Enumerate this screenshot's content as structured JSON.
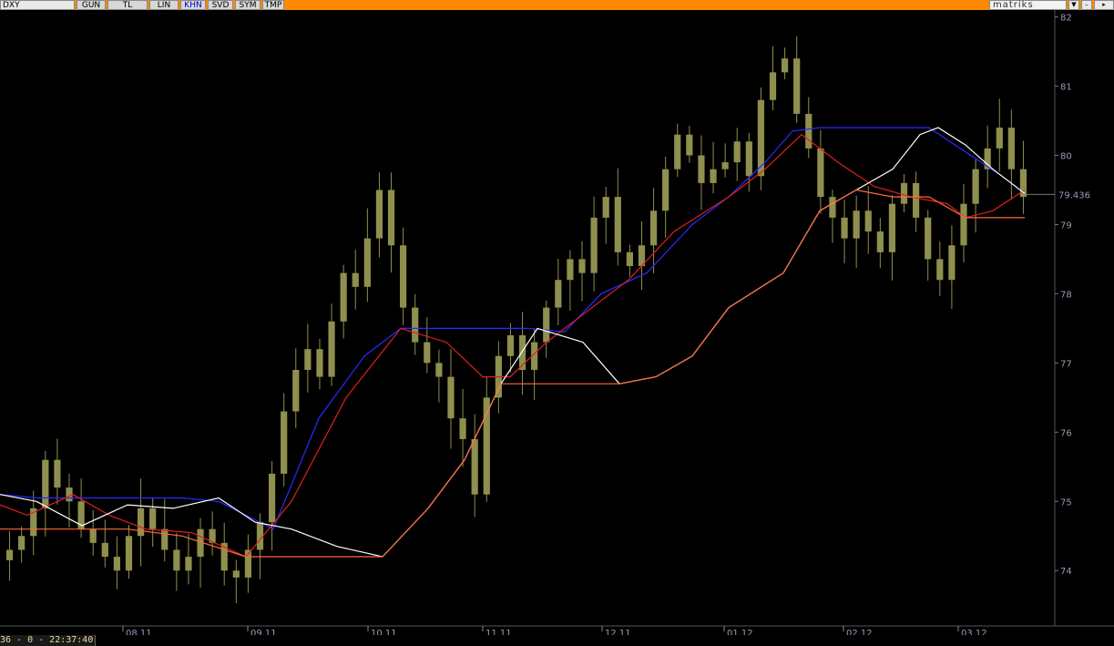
{
  "toolbar": {
    "symbol": "DXY",
    "buttons": [
      "GUN",
      "TL",
      "LIN",
      "KHN",
      "SVD",
      "SYM",
      "TMP"
    ],
    "active": "KHN",
    "brand": "matriks"
  },
  "status": {
    "text": "36 - 0 - 22:37:40"
  },
  "colors": {
    "background": "#000000",
    "candle": "#8f8f4f",
    "ma_blue": "#2a2aff",
    "ma_red": "#e02020",
    "ma_white": "#ffffff",
    "ma_orange": "#ff6a3a",
    "axis_text": "#9a9ab8",
    "toolbar": "#ff8a00"
  },
  "chart_data": {
    "type": "candlestick",
    "current_price": "79.436",
    "y_ticks": [
      "74",
      "75",
      "76",
      "77",
      "78",
      "79",
      "80",
      "81",
      "82"
    ],
    "ylim": [
      73.2,
      82.1
    ],
    "x_labels": [
      "08.11",
      "09.11",
      "10.11",
      "11.11",
      "12.11",
      "01.12",
      "02.12",
      "03.12"
    ],
    "series": [
      {
        "kind": "ohlc",
        "closes": [
          74.3,
          74.5,
          74.9,
          75.6,
          75.2,
          75.0,
          74.6,
          74.4,
          74.2,
          74.0,
          74.5,
          74.9,
          74.6,
          74.3,
          74.0,
          74.2,
          74.6,
          74.4,
          74.0,
          73.9,
          74.3,
          74.7,
          75.4,
          76.3,
          76.9,
          77.2,
          76.8,
          77.6,
          78.3,
          78.1,
          78.8,
          79.5,
          78.7,
          77.8,
          77.3,
          77.0,
          76.8,
          76.2,
          75.9,
          75.1,
          76.5,
          77.1,
          77.4,
          76.9,
          77.3,
          77.8,
          78.2,
          78.5,
          78.3,
          79.1,
          79.4,
          78.6,
          78.4,
          78.7,
          79.2,
          79.8,
          80.3,
          80.0,
          79.6,
          79.8,
          79.9,
          80.2,
          79.7,
          80.8,
          81.2,
          81.4,
          80.6,
          80.1,
          79.4,
          79.1,
          78.8,
          79.2,
          78.9,
          78.6,
          79.3,
          79.6,
          79.1,
          78.5,
          78.2,
          78.7,
          79.3,
          79.8,
          80.1,
          80.4,
          79.8,
          79.4
        ]
      },
      {
        "kind": "ma",
        "name": "",
        "color": "#2a2aff",
        "points": [
          [
            0,
            75.1
          ],
          [
            40,
            75.05
          ],
          [
            100,
            75.05
          ],
          [
            200,
            75.05
          ],
          [
            240,
            75.0
          ],
          [
            270,
            74.8
          ],
          [
            300,
            74.6
          ],
          [
            350,
            76.2
          ],
          [
            400,
            77.1
          ],
          [
            440,
            77.5
          ],
          [
            520,
            77.5
          ],
          [
            580,
            77.5
          ],
          [
            620,
            77.45
          ],
          [
            660,
            78.0
          ],
          [
            710,
            78.3
          ],
          [
            760,
            79.0
          ],
          [
            800,
            79.4
          ],
          [
            840,
            79.9
          ],
          [
            870,
            80.35
          ],
          [
            900,
            80.4
          ],
          [
            950,
            80.4
          ],
          [
            1020,
            80.4
          ],
          [
            1060,
            80.05
          ],
          [
            1100,
            79.7
          ],
          [
            1125,
            79.45
          ]
        ]
      },
      {
        "kind": "ma",
        "name": "",
        "color": "#e02020",
        "points": [
          [
            0,
            74.95
          ],
          [
            30,
            74.8
          ],
          [
            80,
            75.1
          ],
          [
            120,
            74.8
          ],
          [
            160,
            74.6
          ],
          [
            210,
            74.55
          ],
          [
            270,
            74.2
          ],
          [
            320,
            75.0
          ],
          [
            380,
            76.5
          ],
          [
            440,
            77.5
          ],
          [
            490,
            77.3
          ],
          [
            530,
            76.8
          ],
          [
            560,
            76.8
          ],
          [
            600,
            77.3
          ],
          [
            640,
            77.7
          ],
          [
            690,
            78.2
          ],
          [
            740,
            78.9
          ],
          [
            800,
            79.4
          ],
          [
            840,
            79.8
          ],
          [
            880,
            80.3
          ],
          [
            920,
            79.9
          ],
          [
            960,
            79.55
          ],
          [
            1000,
            79.4
          ],
          [
            1040,
            79.3
          ],
          [
            1060,
            79.1
          ],
          [
            1090,
            79.2
          ],
          [
            1125,
            79.5
          ]
        ]
      },
      {
        "kind": "ma",
        "name": "",
        "color": "#ffffff",
        "points": [
          [
            0,
            75.1
          ],
          [
            40,
            75.0
          ],
          [
            90,
            74.65
          ],
          [
            140,
            74.95
          ],
          [
            190,
            74.9
          ],
          [
            240,
            75.05
          ],
          [
            280,
            74.7
          ],
          [
            320,
            74.6
          ],
          [
            370,
            74.35
          ],
          [
            420,
            74.2
          ],
          [
            470,
            74.9
          ],
          [
            510,
            75.6
          ],
          [
            550,
            76.7
          ],
          [
            590,
            77.5
          ],
          [
            640,
            77.3
          ],
          [
            680,
            76.7
          ],
          [
            720,
            76.8
          ],
          [
            760,
            77.1
          ],
          [
            800,
            77.8
          ],
          [
            860,
            78.3
          ],
          [
            900,
            79.2
          ],
          [
            940,
            79.5
          ],
          [
            980,
            79.8
          ],
          [
            1010,
            80.3
          ],
          [
            1030,
            80.4
          ],
          [
            1060,
            80.15
          ],
          [
            1090,
            79.8
          ],
          [
            1125,
            79.45
          ]
        ]
      },
      {
        "kind": "ma",
        "name": "",
        "color": "#ff6a3a",
        "points": [
          [
            0,
            74.6
          ],
          [
            80,
            74.6
          ],
          [
            140,
            74.6
          ],
          [
            200,
            74.5
          ],
          [
            270,
            74.2
          ],
          [
            420,
            74.2
          ],
          [
            470,
            74.9
          ],
          [
            510,
            75.6
          ],
          [
            550,
            76.7
          ],
          [
            600,
            76.7
          ],
          [
            680,
            76.7
          ],
          [
            720,
            76.8
          ],
          [
            760,
            77.1
          ],
          [
            800,
            77.8
          ],
          [
            860,
            78.3
          ],
          [
            900,
            79.2
          ],
          [
            940,
            79.5
          ],
          [
            980,
            79.4
          ],
          [
            1020,
            79.4
          ],
          [
            1060,
            79.1
          ],
          [
            1125,
            79.1
          ]
        ]
      }
    ]
  }
}
